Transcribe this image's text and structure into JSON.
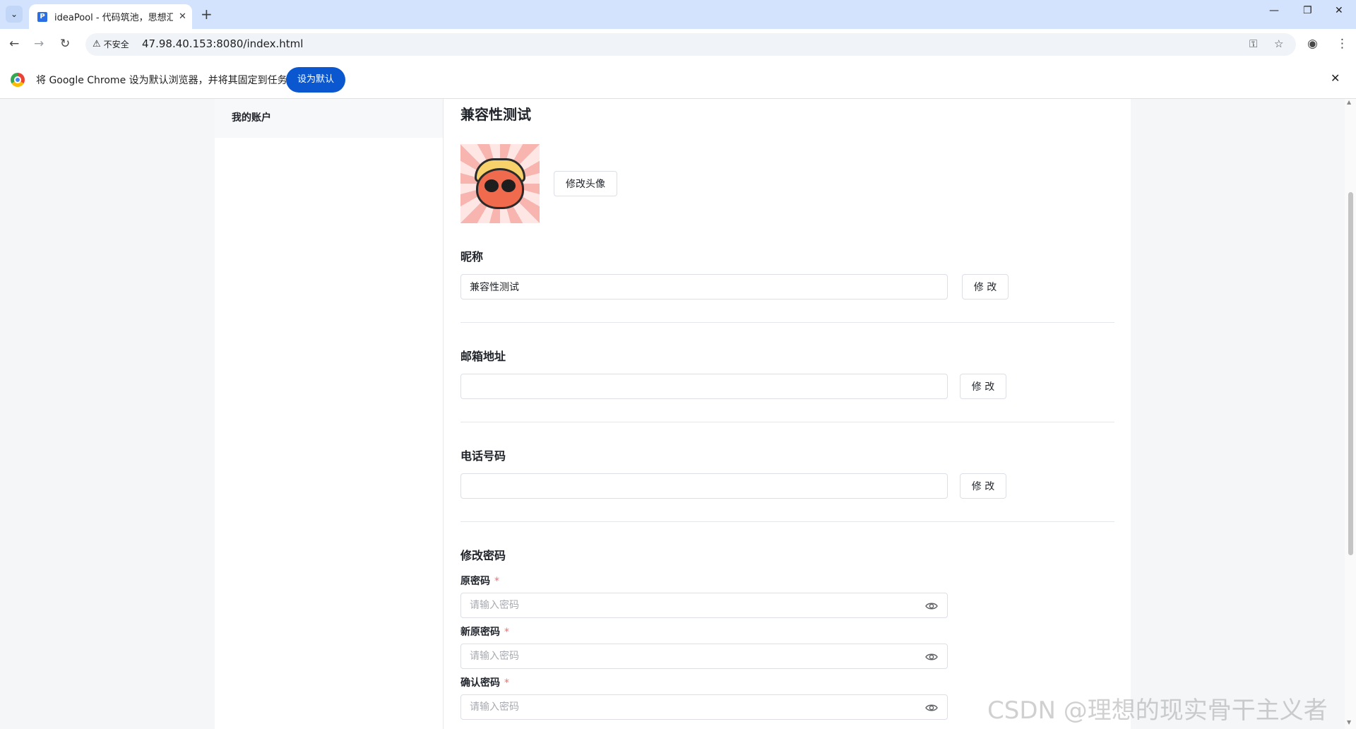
{
  "browser": {
    "tab_title": "ideaPool - 代码筑池，思想汇流",
    "tab_favicon": "P",
    "security_label": "不安全",
    "url": "47.98.40.153:8080/index.html",
    "infobar_text": "将 Google Chrome 设为默认浏览器，并将其固定到任务栏",
    "set_default_label": "设为默认"
  },
  "sidebar": {
    "items": [
      {
        "label": "我的账户"
      }
    ]
  },
  "main": {
    "title": "兼容性测试",
    "avatar_button": "修改头像",
    "nickname": {
      "label": "昵称",
      "value": "兼容性测试",
      "button": "修 改"
    },
    "email": {
      "label": "邮箱地址",
      "value": "",
      "button": "修 改"
    },
    "phone": {
      "label": "电话号码",
      "value": "",
      "button": "修 改"
    },
    "password": {
      "title": "修改密码",
      "old_label": "原密码",
      "new_label": "新原密码",
      "confirm_label": "确认密码",
      "required_mark": "*",
      "placeholder": "请输入密码"
    }
  },
  "watermark": "CSDN @理想的现实骨干主义者",
  "colors": {
    "primary_button": "#0b57d0",
    "tab_strip": "#d3e3fd",
    "required": "#f56c6c",
    "border": "#dcdfe6"
  }
}
